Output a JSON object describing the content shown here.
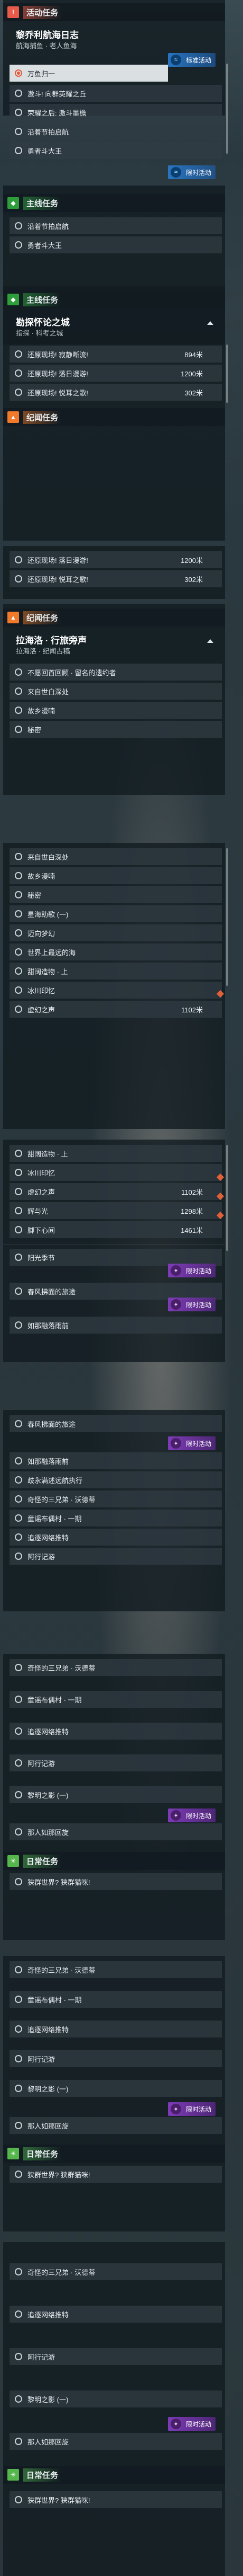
{
  "sections": {
    "event": "活动任务",
    "main": "主线任务",
    "legend": "纪闻任务",
    "daily": "日常任务"
  },
  "block1": {
    "title": "黎乔利航海日志",
    "subtitle": "航海捕鱼 · 老人鱼海",
    "rows": [
      "万鱼归一",
      "激斗! 向群英耀之丘",
      "荣耀之后: 激斗墨檐",
      "沿着节拍启航",
      "勇者斗大王"
    ],
    "tag": "标准活动"
  },
  "block2": {
    "rows": [
      "沿着节拍启航",
      "勇者斗大王"
    ],
    "tag": "限时活动"
  },
  "block3": {
    "title": "勘探怀论之城",
    "subtitle": "指探 · 科考之城",
    "rows": [
      {
        "label": "还原现场! 寂静断流!",
        "dist": "894米"
      },
      {
        "label": "还原现场! 落日漫游!",
        "dist": "1200米"
      },
      {
        "label": "还原现场! 悦耳之歌!",
        "dist": "302米"
      }
    ]
  },
  "block4": {
    "rows": [
      {
        "label": "还原现场! 落日漫游!",
        "dist": "1200米"
      },
      {
        "label": "还原现场! 悦耳之歌!",
        "dist": "302米"
      }
    ]
  },
  "block5": {
    "title": "拉海洛 · 行旅旁声",
    "subtitle": "拉海洛 · 纪闻古稿",
    "rows": [
      "不愿回首回顾 · 留名的遗约者",
      "来自世白深处",
      "故乡漫喃",
      "秘密"
    ]
  },
  "block6": {
    "rows": [
      {
        "label": "来自世白深处",
        "dist": ""
      },
      {
        "label": "故乡漫喃",
        "dist": ""
      },
      {
        "label": "秘密",
        "dist": ""
      },
      {
        "label": "星海助歌 (一)",
        "dist": ""
      },
      {
        "label": "迈向梦幻",
        "dist": ""
      },
      {
        "label": "世界上最远的海",
        "dist": ""
      },
      {
        "label": "甜阔造物 · 上",
        "dist": ""
      },
      {
        "label": "冰川印忆",
        "dist": ""
      },
      {
        "label": "虚幻之声",
        "dist": "1102米"
      }
    ]
  },
  "block7": {
    "rows": [
      {
        "label": "甜阔造物 · 上",
        "dist": ""
      },
      {
        "label": "冰川印忆",
        "dist": ""
      },
      {
        "label": "虚幻之声",
        "dist": "1102米"
      },
      {
        "label": "辉与光",
        "dist": "1298米"
      },
      {
        "label": "脚下心间",
        "dist": "1461米"
      },
      {
        "label": "阳光季节",
        "dist": ""
      },
      {
        "label": "春风拂面的旅途",
        "dist": ""
      },
      {
        "label": "如那融落雨前",
        "dist": ""
      }
    ],
    "tags": [
      "限时活动",
      "限时活动"
    ]
  },
  "block8": {
    "rows": [
      "春风拂面的旅途",
      "如那融落雨前",
      "歧永满述远航执行",
      "奇怪的三兄弟 · 沃德蒂",
      "童谣布偶村 · 一期",
      "追逐网络推特",
      "阿行记游"
    ],
    "tag": "限时活动"
  },
  "block9": {
    "rows": [
      "奇怪的三兄弟 · 沃德蒂",
      "童谣布偶村 · 一期",
      "追逐网络推特",
      "阿行记游",
      "黎明之影 (一)",
      "那人如那回旋"
    ],
    "daily": "狭群世界? 狭群猫咪!",
    "tag": "限时活动"
  },
  "block10": {
    "rows": [
      "奇怪的三兄弟 · 沃德蒂",
      "童谣布偶村 · 一期",
      "追逐网络推特",
      "阿行记游",
      "黎明之影 (一)",
      "那人如那回旋"
    ],
    "daily": "狭群世界? 狭群猫咪!",
    "tag": "限时活动"
  },
  "block11": {
    "rows": [
      "奇怪的三兄弟 · 沃德蒂",
      "追逐网络推特",
      "阿行记游",
      "黎明之影 (一)",
      "那人如那回旋"
    ],
    "daily": "狭群世界? 狭群猫咪!",
    "tag": "限时活动"
  },
  "colors": {
    "event": "#e85a4a",
    "main": "#2e9e3b",
    "legend": "#f07a2a",
    "daily": "#55b64b"
  }
}
